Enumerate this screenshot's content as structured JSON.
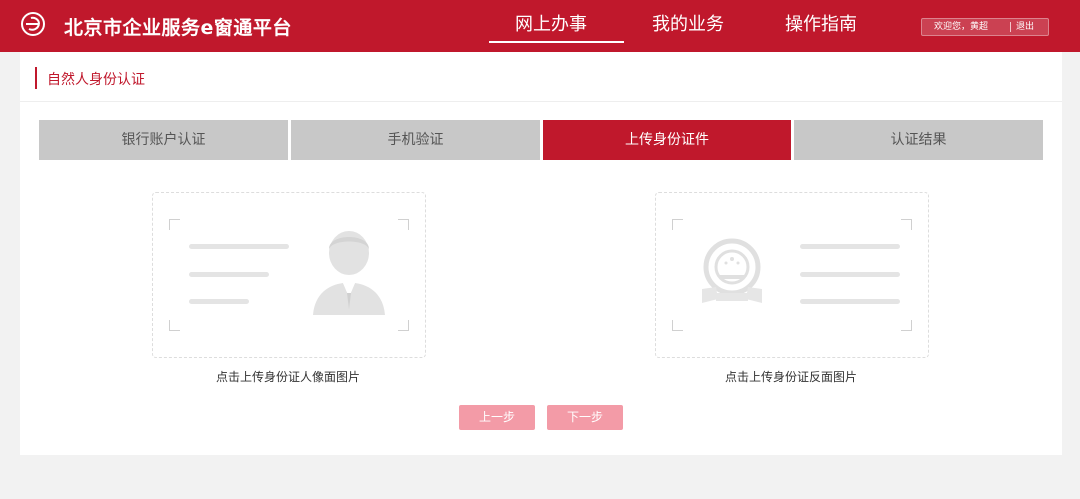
{
  "header": {
    "app_title": "北京市企业服务e窗通平台",
    "nav": [
      {
        "label": "网上办事",
        "active": true
      },
      {
        "label": "我的业务",
        "active": false
      },
      {
        "label": "操作指南",
        "active": false
      }
    ],
    "user_greeting": "欢迎您，黄超",
    "logout": "退出",
    "brand_color": "#c0182c"
  },
  "breadcrumb": {
    "title": "自然人身份认证"
  },
  "steps": [
    {
      "label": "银行账户认证",
      "active": false
    },
    {
      "label": "手机验证",
      "active": false
    },
    {
      "label": "上传身份证件",
      "active": true
    },
    {
      "label": "认证结果",
      "active": false
    }
  ],
  "uploads": {
    "front_label": "点击上传身份证人像面图片",
    "back_label": "点击上传身份证反面图片"
  },
  "buttons": {
    "prev": "上一步",
    "next": "下一步"
  },
  "icons": [
    "e-logo-icon",
    "id-front-placeholder-icon",
    "id-back-emblem-placeholder-icon"
  ]
}
